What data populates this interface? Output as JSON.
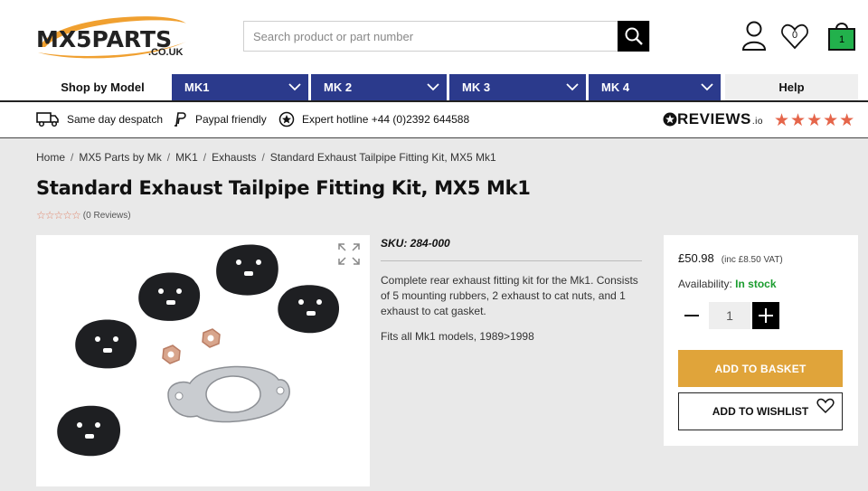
{
  "header": {
    "logo_text": "MX5PARTS",
    "logo_domain": ".CO.UK",
    "search_placeholder": "Search product or part number",
    "wishlist_count": "0",
    "basket_count": "1"
  },
  "nav": {
    "shop_by_model": "Shop by Model",
    "models": [
      "MK1",
      "MK 2",
      "MK 3",
      "MK 4"
    ],
    "help": "Help"
  },
  "usp": {
    "despatch": "Same day despatch",
    "paypal": "Paypal friendly",
    "hotline": "Expert hotline +44 (0)2392 644588",
    "reviews_brand": "REVIEWS",
    "reviews_io": ".io",
    "reviews_stars": "★★★★★"
  },
  "breadcrumb": [
    "Home",
    "MX5 Parts by Mk",
    "MK1",
    "Exhausts",
    "Standard Exhaust Tailpipe Fitting Kit, MX5 Mk1"
  ],
  "product": {
    "title": "Standard Exhaust Tailpipe Fitting Kit, MX5 Mk1",
    "rating_stars": "☆☆☆☆☆",
    "reviews_count": "(0 Reviews)",
    "sku": "SKU: 284-000",
    "description": "Complete rear exhaust fitting kit for the Mk1. Consists of 5 mounting rubbers, 2 exhaust to cat nuts, and 1 exhaust to cat gasket.",
    "fits": "Fits all Mk1 models, 1989>1998"
  },
  "buybox": {
    "price": "£50.98",
    "vat": "(inc £8.50 VAT)",
    "availability_label": "Availability:",
    "availability_value": "In stock",
    "quantity": "1",
    "add_to_basket": "ADD TO BASKET",
    "add_to_wishlist": "ADD TO WISHLIST"
  },
  "colors": {
    "nav_blue": "#2b3a8c",
    "basket_button": "#e0a43a",
    "in_stock": "#1a9c2e",
    "basket_icon": "#22b14c",
    "logo_orange": "#f0a030"
  }
}
